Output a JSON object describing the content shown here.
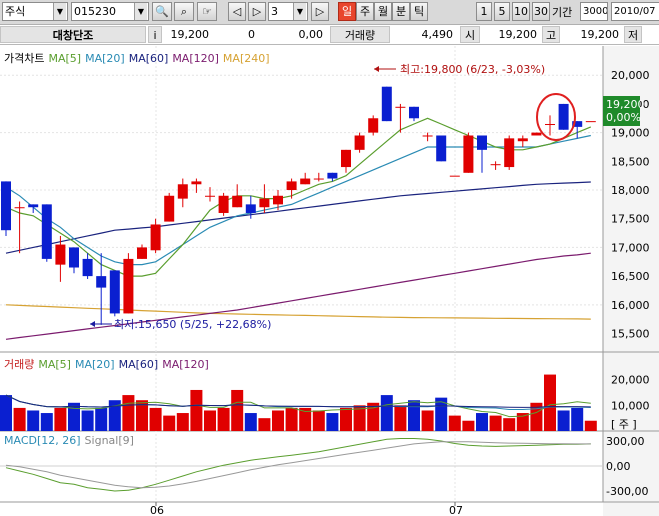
{
  "toolbar": {
    "market_select": "주식",
    "stock_code": "015230",
    "tick_value": "3",
    "period_buttons": [
      "일",
      "주",
      "월",
      "분",
      "틱"
    ],
    "count_buttons": [
      "1",
      "5",
      "10",
      "30"
    ],
    "range_label": "기간",
    "range_value": "3000",
    "date_value": "2010/07"
  },
  "info": {
    "name": "대창단조",
    "i_label": "i",
    "price": "19,200",
    "change": "0",
    "rate": "0,00",
    "volume_label": "거래량",
    "volume": "4,490",
    "open_label": "시",
    "open": "19,200",
    "high_label": "고",
    "high": "19,200",
    "low_label": "저"
  },
  "price_panel": {
    "legend": [
      {
        "text": "가격차트",
        "color": "#000000"
      },
      {
        "text": "MA[5]",
        "color": "#5a9e2e"
      },
      {
        "text": "MA[20]",
        "color": "#2a8bb4"
      },
      {
        "text": "MA[60]",
        "color": "#1a237e"
      },
      {
        "text": "MA[120]",
        "color": "#7b1b6e"
      },
      {
        "text": "MA[240]",
        "color": "#d6a233"
      }
    ],
    "high_annotation": "최고:19,800 (6/23, -3,03%)",
    "low_annotation": "최저:15,650 (5/25, +22,68%)",
    "current_price": "19,200",
    "current_rate": "0,00%",
    "y_ticks": [
      "20,000",
      "19,500",
      "19,000",
      "18,500",
      "18,000",
      "17,500",
      "17,000",
      "16,500",
      "16,000",
      "15,500"
    ]
  },
  "volume_panel": {
    "legend": [
      {
        "text": "거래량",
        "color": "#c41c1c"
      },
      {
        "text": "MA[5]",
        "color": "#5a9e2e"
      },
      {
        "text": "MA[20]",
        "color": "#2a8bb4"
      },
      {
        "text": "MA[60]",
        "color": "#1a237e"
      },
      {
        "text": "MA[120]",
        "color": "#7b1b6e"
      }
    ],
    "y_ticks": [
      "20,000",
      "10,000"
    ],
    "unit": "[ 주 ]"
  },
  "macd_panel": {
    "legend": [
      {
        "text": "MACD[12, 26]",
        "color": "#2a8bb4"
      },
      {
        "text": "Signal[9]",
        "color": "#888888"
      }
    ],
    "y_ticks": [
      "300,00",
      "0,00",
      "-300,00"
    ]
  },
  "x_labels": [
    "06",
    "07"
  ],
  "colors": {
    "up": "#e00000",
    "down": "#0a1fd0",
    "ma5": "#5a9e2e",
    "ma20": "#2a8bb4",
    "ma60": "#1a237e",
    "ma120": "#7b1b6e",
    "ma240": "#d6a233"
  },
  "chart_data": {
    "type": "candlestick",
    "y_range": [
      15300,
      20300
    ],
    "candles": [
      {
        "o": 18150,
        "h": 18150,
        "l": 17200,
        "c": 17300
      },
      {
        "o": 17700,
        "h": 17800,
        "l": 16900,
        "c": 17700
      },
      {
        "o": 17750,
        "h": 17750,
        "l": 17600,
        "c": 17700
      },
      {
        "o": 17750,
        "h": 17750,
        "l": 16750,
        "c": 16800
      },
      {
        "o": 16700,
        "h": 17200,
        "l": 16400,
        "c": 17050
      },
      {
        "o": 17000,
        "h": 17000,
        "l": 16550,
        "c": 16650
      },
      {
        "o": 16800,
        "h": 16900,
        "l": 16450,
        "c": 16500
      },
      {
        "o": 16500,
        "h": 16900,
        "l": 15650,
        "c": 16300
      },
      {
        "o": 16600,
        "h": 16600,
        "l": 15800,
        "c": 15850
      },
      {
        "o": 15850,
        "h": 16900,
        "l": 15850,
        "c": 16800
      },
      {
        "o": 16800,
        "h": 17050,
        "l": 16800,
        "c": 17000
      },
      {
        "o": 16950,
        "h": 17500,
        "l": 16900,
        "c": 17400
      },
      {
        "o": 17450,
        "h": 17950,
        "l": 17450,
        "c": 17900
      },
      {
        "o": 17850,
        "h": 18200,
        "l": 17700,
        "c": 18100
      },
      {
        "o": 18100,
        "h": 18200,
        "l": 17950,
        "c": 18150
      },
      {
        "o": 17900,
        "h": 18050,
        "l": 17800,
        "c": 17900
      },
      {
        "o": 17600,
        "h": 17950,
        "l": 17550,
        "c": 17900
      },
      {
        "o": 17700,
        "h": 18100,
        "l": 17700,
        "c": 17900
      },
      {
        "o": 17750,
        "h": 17900,
        "l": 17500,
        "c": 17600
      },
      {
        "o": 17700,
        "h": 18100,
        "l": 17600,
        "c": 17850
      },
      {
        "o": 17750,
        "h": 18000,
        "l": 17650,
        "c": 17900
      },
      {
        "o": 18000,
        "h": 18200,
        "l": 17850,
        "c": 18150
      },
      {
        "o": 18100,
        "h": 18300,
        "l": 18100,
        "c": 18200
      },
      {
        "o": 18200,
        "h": 18300,
        "l": 18150,
        "c": 18200
      },
      {
        "o": 18300,
        "h": 18300,
        "l": 18150,
        "c": 18200
      },
      {
        "o": 18400,
        "h": 18700,
        "l": 18300,
        "c": 18700
      },
      {
        "o": 18700,
        "h": 19000,
        "l": 18650,
        "c": 18950
      },
      {
        "o": 19000,
        "h": 19300,
        "l": 18950,
        "c": 19250
      },
      {
        "o": 19800,
        "h": 19800,
        "l": 19200,
        "c": 19200
      },
      {
        "o": 19450,
        "h": 19500,
        "l": 19000,
        "c": 19450
      },
      {
        "o": 19450,
        "h": 19450,
        "l": 19200,
        "c": 19250
      },
      {
        "o": 18950,
        "h": 19000,
        "l": 18850,
        "c": 18950
      },
      {
        "o": 18950,
        "h": 18950,
        "l": 18500,
        "c": 18500
      },
      {
        "o": 18250,
        "h": 18250,
        "l": 18250,
        "c": 18250
      },
      {
        "o": 18300,
        "h": 19000,
        "l": 18300,
        "c": 18950
      },
      {
        "o": 18950,
        "h": 18950,
        "l": 18300,
        "c": 18700
      },
      {
        "o": 18450,
        "h": 18500,
        "l": 18350,
        "c": 18450
      },
      {
        "o": 18400,
        "h": 18950,
        "l": 18350,
        "c": 18900
      },
      {
        "o": 18850,
        "h": 18950,
        "l": 18750,
        "c": 18900
      },
      {
        "o": 18950,
        "h": 19000,
        "l": 18950,
        "c": 19000
      },
      {
        "o": 19150,
        "h": 19300,
        "l": 18950,
        "c": 19150
      },
      {
        "o": 19500,
        "h": 19500,
        "l": 19050,
        "c": 19050
      },
      {
        "o": 19200,
        "h": 19200,
        "l": 18900,
        "c": 19100
      },
      {
        "o": 19200,
        "h": 19200,
        "l": 19200,
        "c": 19200
      }
    ],
    "ma5": [
      17700,
      17600,
      17550,
      17400,
      17250,
      17100,
      16900,
      16700,
      16600,
      16500,
      16500,
      16550,
      16800,
      17050,
      17350,
      17650,
      17800,
      17900,
      17900,
      17850,
      17850,
      17900,
      18000,
      18100,
      18150,
      18250,
      18450,
      18650,
      18850,
      19050,
      19150,
      19250,
      19150,
      19050,
      18950,
      18850,
      18750,
      18700,
      18700,
      18750,
      18800,
      18900,
      19000,
      19100
    ],
    "ma20": [
      18050,
      17900,
      17700,
      17500,
      17350,
      17150,
      17000,
      16850,
      16750,
      16700,
      16700,
      16750,
      16900,
      17050,
      17200,
      17350,
      17450,
      17550,
      17600,
      17650,
      17700,
      17750,
      17850,
      17950,
      18050,
      18150,
      18250,
      18350,
      18450,
      18550,
      18650,
      18750,
      18750,
      18750,
      18750,
      18750,
      18750,
      18750,
      18750,
      18750,
      18800,
      18850,
      18900,
      18950
    ],
    "ma60": [
      16900,
      16950,
      17000,
      17050,
      17100,
      17150,
      17200,
      17250,
      17300,
      17320,
      17340,
      17360,
      17390,
      17420,
      17450,
      17480,
      17510,
      17540,
      17570,
      17600,
      17630,
      17660,
      17690,
      17720,
      17750,
      17780,
      17810,
      17840,
      17870,
      17900,
      17920,
      17940,
      17960,
      17980,
      18000,
      18020,
      18040,
      18060,
      18080,
      18100,
      18110,
      18120,
      18130,
      18140
    ],
    "ma120": [
      15400,
      15430,
      15460,
      15490,
      15520,
      15550,
      15580,
      15610,
      15640,
      15670,
      15700,
      15730,
      15760,
      15790,
      15820,
      15850,
      15880,
      15910,
      15950,
      15990,
      16030,
      16070,
      16110,
      16150,
      16190,
      16230,
      16270,
      16310,
      16350,
      16390,
      16430,
      16470,
      16510,
      16550,
      16590,
      16630,
      16670,
      16710,
      16750,
      16790,
      16820,
      16850,
      16870,
      16900
    ],
    "ma240": [
      16000,
      15990,
      15980,
      15970,
      15960,
      15950,
      15940,
      15930,
      15920,
      15910,
      15900,
      15890,
      15880,
      15870,
      15860,
      15850,
      15845,
      15840,
      15835,
      15830,
      15825,
      15820,
      15815,
      15810,
      15805,
      15800,
      15795,
      15790,
      15785,
      15780,
      15778,
      15776,
      15774,
      15772,
      15770,
      15768,
      15766,
      15764,
      15762,
      15760,
      15758,
      15756,
      15754,
      15752
    ],
    "volume": [
      14000,
      9000,
      8000,
      7000,
      9000,
      11000,
      8000,
      9000,
      12000,
      14000,
      12000,
      9000,
      6000,
      7000,
      16000,
      8000,
      9000,
      16000,
      7000,
      5000,
      8000,
      9000,
      9000,
      8000,
      7000,
      9000,
      10000,
      11000,
      14000,
      10000,
      12000,
      8000,
      13000,
      6000,
      4000,
      7000,
      6000,
      5000,
      7000,
      11000,
      22000,
      8000,
      9000,
      4000
    ],
    "macd": [
      -20,
      -60,
      -100,
      -150,
      -200,
      -220,
      -260,
      -280,
      -300,
      -290,
      -260,
      -220,
      -170,
      -120,
      -70,
      -30,
      10,
      40,
      70,
      90,
      110,
      130,
      150,
      170,
      200,
      230,
      260,
      290,
      320,
      330,
      330,
      320,
      300,
      270,
      250,
      240,
      235,
      240,
      245,
      250,
      255,
      260,
      262,
      265
    ],
    "signal": [
      10,
      -10,
      -40,
      -70,
      -110,
      -140,
      -170,
      -200,
      -230,
      -250,
      -260,
      -255,
      -240,
      -215,
      -185,
      -150,
      -115,
      -80,
      -45,
      -15,
      15,
      40,
      65,
      90,
      115,
      140,
      165,
      190,
      215,
      240,
      265,
      280,
      290,
      292,
      290,
      285,
      280,
      275,
      272,
      270,
      268,
      266,
      265,
      265
    ]
  }
}
